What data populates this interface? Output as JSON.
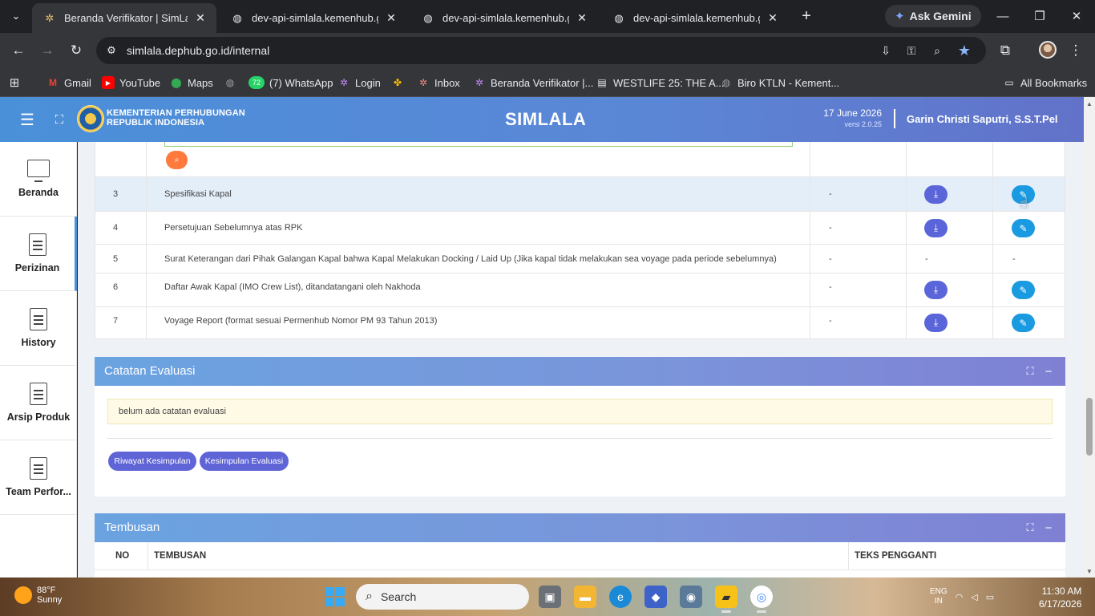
{
  "browser": {
    "tabs": [
      {
        "title": "Beranda Verifikator | SimLala",
        "active": true
      },
      {
        "title": "dev-api-simlala.kemenhub.go.id",
        "active": false
      },
      {
        "title": "dev-api-simlala.kemenhub.go.id",
        "active": false
      },
      {
        "title": "dev-api-simlala.kemenhub.go.id",
        "active": false
      }
    ],
    "gemini_label": "Ask Gemini",
    "url": "simlala.dephub.go.id/internal",
    "bookmarks": [
      {
        "label": "Gmail",
        "icon": "gmail-icon",
        "color": "#ea4335"
      },
      {
        "label": "YouTube",
        "icon": "youtube-icon",
        "color": "#ff0000"
      },
      {
        "label": "Maps",
        "icon": "maps-icon",
        "color": "#34a853"
      },
      {
        "label": "",
        "icon": "globe-icon",
        "color": "#9aa0a6"
      },
      {
        "label": "(7) WhatsApp",
        "icon": "whatsapp-icon",
        "color": "#25d366",
        "badge": "72"
      },
      {
        "label": "Login",
        "icon": "login-icon",
        "color": "#c58af9"
      },
      {
        "label": "",
        "icon": "pinwheel-icon",
        "color": "#fbbc04"
      },
      {
        "label": "Inbox",
        "icon": "inbox-icon",
        "color": "#f28b82"
      },
      {
        "label": "Beranda Verifikator |...",
        "icon": "simlala-icon",
        "color": "#c58af9"
      },
      {
        "label": "WESTLIFE 25: THE A...",
        "icon": "page-icon",
        "color": "#e8eaed"
      },
      {
        "label": "Biro KTLN - Kement...",
        "icon": "globe-icon",
        "color": "#9aa0a6"
      }
    ],
    "all_bookmarks": "All Bookmarks"
  },
  "header": {
    "ministry_line1": "KEMENTERIAN PERHUBUNGAN",
    "ministry_line2": "REPUBLIK INDONESIA",
    "app_name": "SIMLALA",
    "date": "17 June 2026",
    "version": "versi 2.0.25",
    "user": "Garin Christi Saputri, S.S.T.Pel"
  },
  "sidebar": {
    "items": [
      {
        "label": "Beranda",
        "icon": "monitor-icon"
      },
      {
        "label": "Perizinan",
        "icon": "document-icon",
        "active": true
      },
      {
        "label": "History",
        "icon": "document-icon"
      },
      {
        "label": "Arsip Produk",
        "icon": "document-icon"
      },
      {
        "label": "Team Perfor...",
        "icon": "document-icon"
      }
    ]
  },
  "documents": {
    "rows": [
      {
        "no": "3",
        "name": "Spesifikasi Kapal",
        "status": "-",
        "download": true,
        "edit": true,
        "highlight": true
      },
      {
        "no": "4",
        "name": "Persetujuan Sebelumnya atas RPK",
        "status": "-",
        "download": true,
        "edit": true
      },
      {
        "no": "5",
        "name": "Surat Keterangan dari Pihak Galangan Kapal bahwa Kapal Melakukan Docking / Laid Up (Jika kapal tidak melakukan sea voyage pada periode sebelumnya)",
        "status": "-",
        "download_text": "-",
        "edit_text": "-"
      },
      {
        "no": "6",
        "name": "Daftar Awak Kapal (IMO Crew List), ditandatangani oleh Nakhoda",
        "status": "-",
        "download": true,
        "edit": true
      },
      {
        "no": "7",
        "name": "Voyage Report (format sesuai Permenhub Nomor PM 93 Tahun 2013)",
        "status": "-",
        "download": true,
        "edit": true
      }
    ]
  },
  "evaluation": {
    "title": "Catatan Evaluasi",
    "notice": "belum ada catatan evaluasi",
    "btn_history": "Riwayat Kesimpulan",
    "btn_conclusion": "Kesimpulan Evaluasi"
  },
  "tembusan": {
    "title": "Tembusan",
    "col_no": "NO",
    "col_tembusan": "TEMBUSAN",
    "col_teks": "TEKS PENGGANTI"
  },
  "taskbar": {
    "temp": "88°F",
    "weather": "Sunny",
    "search": "Search",
    "lang1": "ENG",
    "lang2": "IN",
    "time": "11:30 AM",
    "date": "6/17/2026"
  },
  "colors": {
    "header_gradient_start": "#4a90d9",
    "download_button": "#5965d8",
    "edit_button": "#1a9ae0",
    "pill_button": "#5f64d6",
    "orange_button": "#ff7a3d"
  }
}
